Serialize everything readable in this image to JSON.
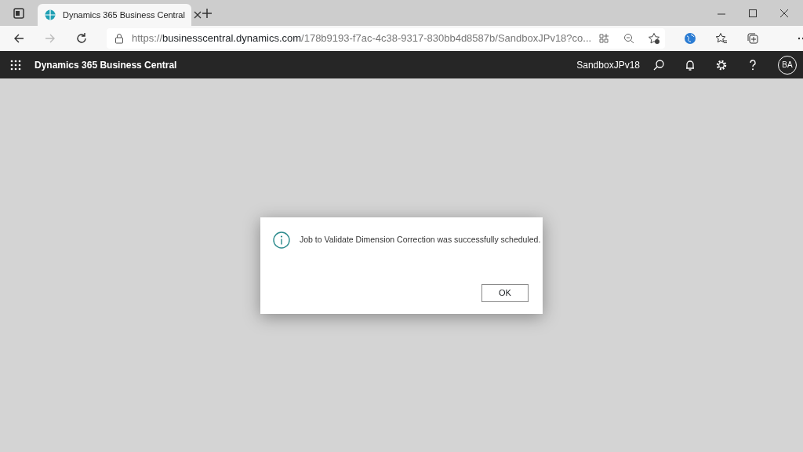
{
  "browser": {
    "tabs": [
      {
        "title": "Dynamics 365 Business Central",
        "selected": true
      }
    ],
    "url": {
      "scheme": "https://",
      "host": "businesscentral.dynamics.com",
      "path": "/178b9193-f7ac-4c38-9317-830bb4d8587b/SandboxJPv18?co..."
    }
  },
  "app_bar": {
    "title": "Dynamics 365 Business Central",
    "company": "SandboxJPv18",
    "user_initials": "BA"
  },
  "dialog": {
    "message": "Job to Validate Dimension Correction was successfully scheduled.",
    "buttons": [
      "OK"
    ]
  }
}
